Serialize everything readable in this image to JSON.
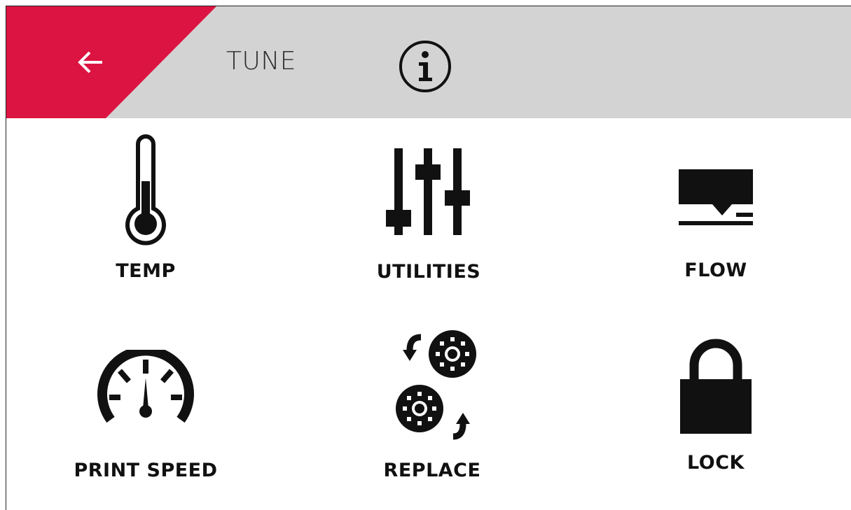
{
  "header": {
    "title": "TUNE",
    "back_icon": "arrow-left-icon",
    "info_icon": "info-icon",
    "accent_color": "#dc1442",
    "bar_color": "#d3d3d3"
  },
  "tiles": [
    {
      "label": "TEMP",
      "icon": "thermometer-icon"
    },
    {
      "label": "UTILITIES",
      "icon": "sliders-icon"
    },
    {
      "label": "FLOW",
      "icon": "flow-icon"
    },
    {
      "label": "PRINT SPEED",
      "icon": "speedometer-icon"
    },
    {
      "label": "REPLACE",
      "icon": "replace-spools-icon"
    },
    {
      "label": "LOCK",
      "icon": "lock-icon"
    }
  ]
}
